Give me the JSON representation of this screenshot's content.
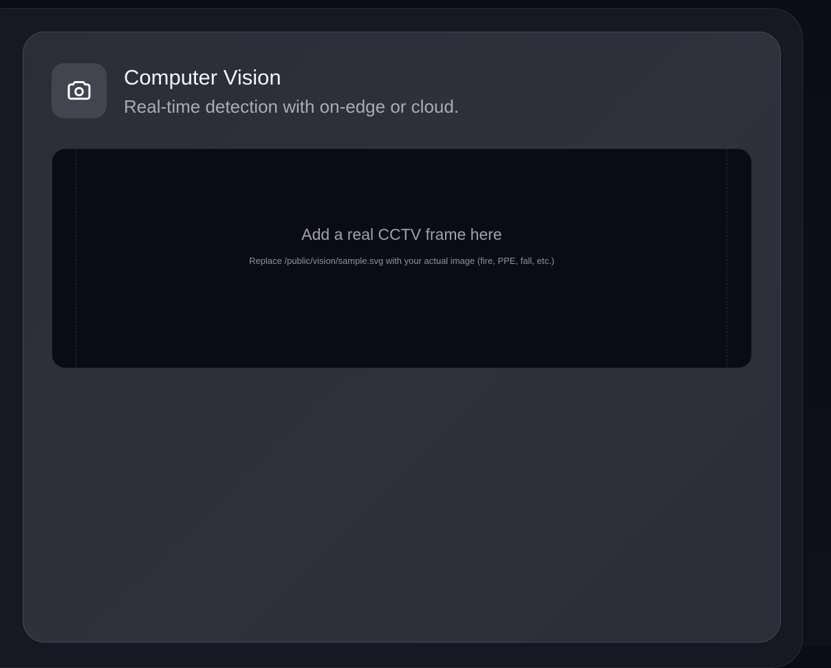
{
  "card": {
    "icon": "camera-icon",
    "title": "Computer Vision",
    "subtitle": "Real-time detection with on-edge or cloud."
  },
  "frame": {
    "title": "Add a real CCTV frame here",
    "hint": "Replace /public/vision/sample.svg with your actual image (fire, PPE, fall, etc.)"
  },
  "colors": {
    "page_background": "#0b0d16",
    "card_background": "#2d2f3b",
    "frame_background": "#090c15",
    "title_text": "#f3f4f7",
    "muted_text": "#a9abb6"
  }
}
